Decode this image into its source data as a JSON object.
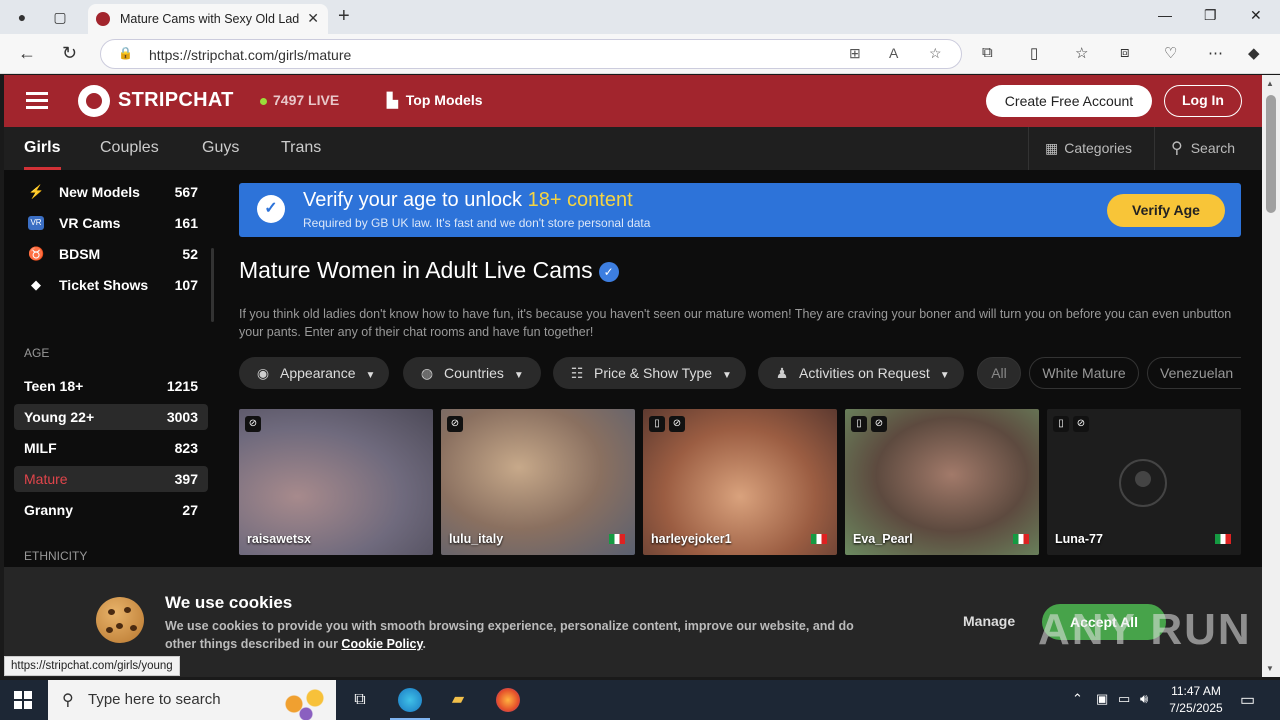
{
  "browser": {
    "tab_title": "Mature Cams with Sexy Old Ladies",
    "url": "https://stripchat.com/girls/mature",
    "status_url": "https://stripchat.com/girls/young"
  },
  "header": {
    "logo_text": "STRIPCHAT",
    "live_count": "7497",
    "live_label": "LIVE",
    "top_models": "Top Models",
    "create_account": "Create Free Account",
    "login": "Log In"
  },
  "subnav": {
    "tabs": [
      "Girls",
      "Couples",
      "Guys",
      "Trans"
    ],
    "categories": "Categories",
    "search": "Search"
  },
  "sidebar": {
    "items": [
      {
        "icon": "lightning-icon",
        "label": "New Models",
        "count": "567"
      },
      {
        "icon": "vr-icon",
        "label": "VR Cams",
        "count": "161"
      },
      {
        "icon": "bdsm-icon",
        "label": "BDSM",
        "count": "52"
      },
      {
        "icon": "ticket-icon",
        "label": "Ticket Shows",
        "count": "107"
      }
    ],
    "age_heading": "AGE",
    "age_items": [
      {
        "label": "Teen 18+",
        "count": "1215"
      },
      {
        "label": "Young 22+",
        "count": "3003"
      },
      {
        "label": "MILF",
        "count": "823"
      },
      {
        "label": "Mature",
        "count": "397"
      },
      {
        "label": "Granny",
        "count": "27"
      }
    ],
    "ethnicity_heading": "ETHNICITY"
  },
  "verify": {
    "title_start": "Verify your age to unlock",
    "title_highlight": "18+ content",
    "subtitle": "Required by GB UK law. It's fast and we don't store personal data",
    "button": "Verify Age"
  },
  "page": {
    "title": "Mature Women in Adult Live Cams",
    "description": "If you think old ladies don't know how to have fun, it's because you haven't seen our mature women! They are craving your boner and will turn you on before you can even unbutton your pants. Enter any of their chat rooms and have fun together!"
  },
  "filters": {
    "buttons": [
      "Appearance",
      "Countries",
      "Price & Show Type",
      "Activities on Request"
    ],
    "chips": [
      "All",
      "White Mature",
      "Venezuelan"
    ]
  },
  "models": [
    {
      "name": "raisawetsx",
      "flag": false
    },
    {
      "name": "lulu_italy",
      "flag": true
    },
    {
      "name": "harleyejoker1",
      "flag": true
    },
    {
      "name": "Eva_Pearl",
      "flag": true
    },
    {
      "name": "Luna-77",
      "flag": true
    }
  ],
  "cookie": {
    "title": "We use cookies",
    "body": "We use cookies to provide you with smooth browsing experience, personalize content, improve our website, and do other things described in our",
    "link": "Cookie Policy",
    "manage": "Manage",
    "accept": "Accept All"
  },
  "watermark": "ANY RUN",
  "taskbar": {
    "search_placeholder": "Type here to search",
    "time": "11:47 AM",
    "date": "7/25/2025"
  },
  "colors": {
    "brand": "#a2252d",
    "verify_bg": "#2d73d9",
    "accent_yellow": "#f8c538",
    "accept_green": "#47a34a"
  }
}
